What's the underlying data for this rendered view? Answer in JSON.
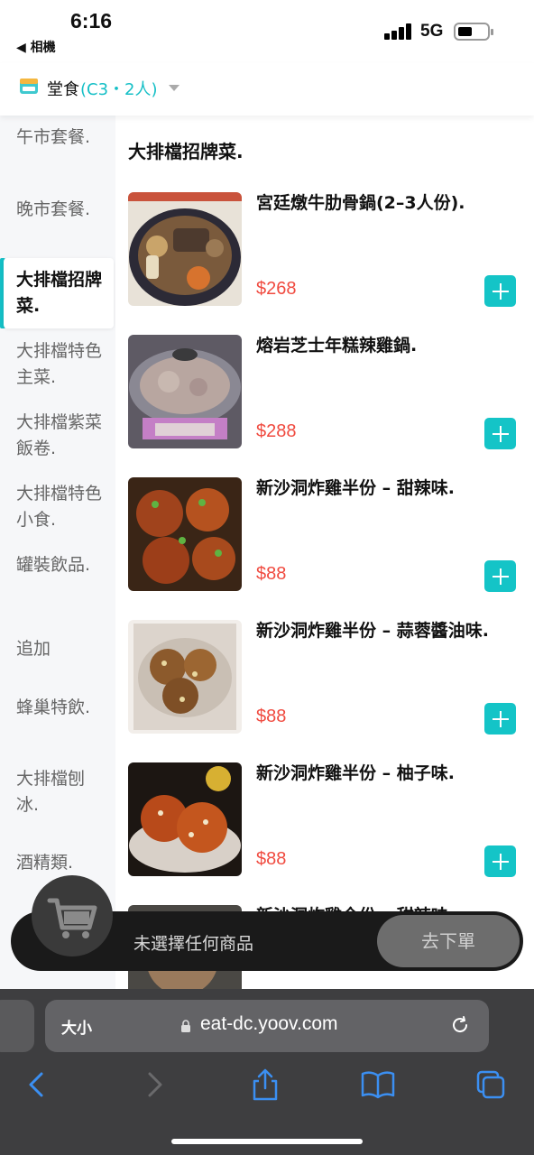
{
  "status_bar": {
    "time": "6:16",
    "back_app": "◀ 相機",
    "network": "5G"
  },
  "header": {
    "dine_label": "堂食",
    "table_info": "(C3・2人)",
    "dine_icon": "store-icon"
  },
  "sidebar": {
    "categories": [
      {
        "label": "午市套餐.",
        "active": false
      },
      {
        "label": "晚市套餐.",
        "active": false
      },
      {
        "label": "大排檔招牌菜.",
        "active": true
      },
      {
        "label": "大排檔特色主菜.",
        "active": false
      },
      {
        "label": "大排檔紫菜飯卷.",
        "active": false
      },
      {
        "label": "大排檔特色小食.",
        "active": false
      },
      {
        "label": "罐裝飲品.",
        "active": false
      },
      {
        "label": "追加",
        "active": false
      },
      {
        "label": "蜂巢特飲.",
        "active": false
      },
      {
        "label": "大排檔刨冰.",
        "active": false
      },
      {
        "label": "酒精類.",
        "active": false
      }
    ]
  },
  "main": {
    "section_title": "大排檔招牌菜.",
    "items": [
      {
        "name": "宮廷燉牛肋骨鍋(2–3人份).",
        "price": "$268"
      },
      {
        "name": "熔岩芝士年糕辣雞鍋.",
        "price": "$288"
      },
      {
        "name": "新沙洞炸雞半份 – 甜辣味.",
        "price": "$88"
      },
      {
        "name": "新沙洞炸雞半份 – 蒜蓉醬油味.",
        "price": "$88"
      },
      {
        "name": "新沙洞炸雞半份 – 柚子味.",
        "price": "$88"
      },
      {
        "name": "新沙洞炸雞全份 – 甜辣味.",
        "price": ""
      }
    ]
  },
  "cart": {
    "empty_text": "未選擇任何商品",
    "order_button": "去下單",
    "icon": "cart-icon"
  },
  "browser": {
    "text_size": "大小",
    "url": "eat-dc.yoov.com"
  },
  "colors": {
    "accent": "#14bfc6",
    "price": "#f04a3f"
  }
}
